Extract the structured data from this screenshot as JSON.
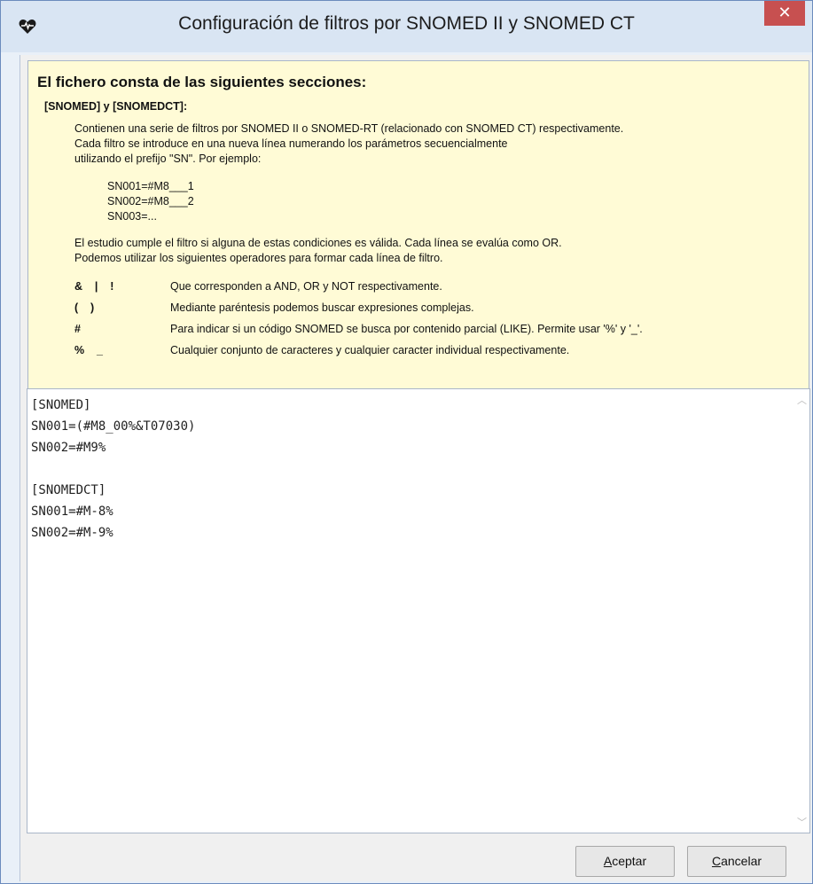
{
  "window": {
    "title": "Configuración de filtros por SNOMED II y SNOMED CT",
    "app_icon": "heart-pulse-icon",
    "close_icon": "close-icon",
    "close_symbol": "✕",
    "accent_close": "#c75050"
  },
  "help": {
    "heading": "El fichero consta de las siguientes secciones:",
    "section": "[SNOMED] y [SNOMEDCT]:",
    "intro_lines": [
      "Contienen una serie de filtros por SNOMED II o SNOMED-RT (relacionado con SNOMED CT) respectivamente.",
      "Cada filtro se introduce en una nueva línea numerando los parámetros secuencialmente",
      "utilizando el prefijo \"SN\". Por ejemplo:"
    ],
    "example_lines": [
      "SN001=#M8___1",
      "SN002=#M8___2",
      "SN003=..."
    ],
    "rule_lines": [
      "El estudio cumple el filtro si alguna de estas condiciones es válida. Cada línea se evalúa como OR.",
      "Podemos utilizar los siguientes operadores para formar cada línea de filtro."
    ],
    "operators": [
      {
        "symbol": "&    |    !",
        "description": "Que corresponden a AND, OR y NOT respectivamente."
      },
      {
        "symbol": "(    )",
        "description": "Mediante paréntesis podemos buscar expresiones complejas."
      },
      {
        "symbol": "#",
        "description": "Para indicar si un código SNOMED se busca por contenido parcial (LIKE). Permite usar '%' y '_'."
      },
      {
        "symbol": "%    _",
        "description": "Cualquier conjunto de caracteres y cualquier caracter individual respectivamente."
      }
    ],
    "background": "#fffbd6"
  },
  "editor": {
    "lines": [
      "[SNOMED]",
      "SN001=(#M8_00%&T07030)",
      "SN002=#M9%",
      "",
      "[SNOMEDCT]",
      "SN001=#M-8%",
      "SN002=#M-9%"
    ],
    "scroll_up_icon": "chevron-up-icon",
    "scroll_down_icon": "chevron-down-icon",
    "up_symbol": "︿",
    "down_symbol": "﹀"
  },
  "buttons": {
    "accept_mnemonic": "A",
    "accept_rest": "ceptar",
    "cancel_mnemonic": "C",
    "cancel_rest": "ancelar"
  }
}
